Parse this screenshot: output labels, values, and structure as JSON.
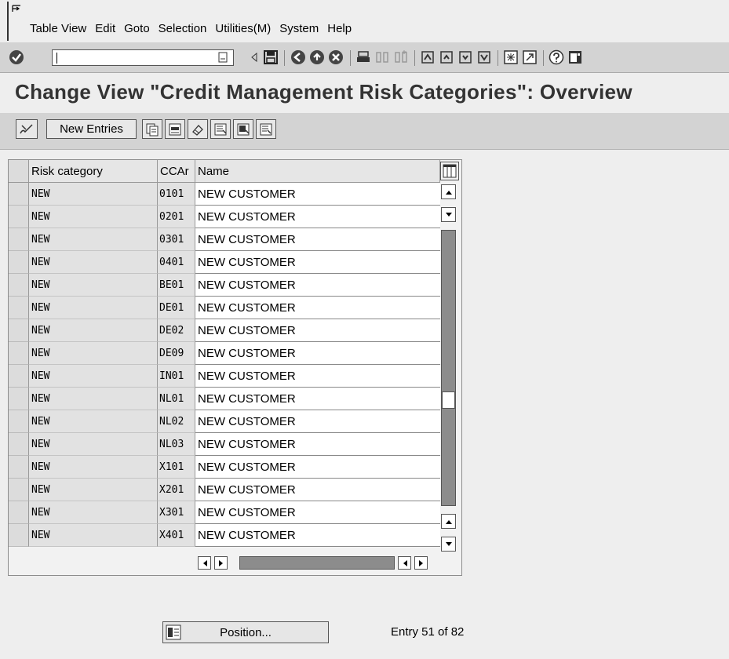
{
  "menu": {
    "items": [
      {
        "label": "Table View"
      },
      {
        "label": "Edit"
      },
      {
        "label": "Goto"
      },
      {
        "label": "Selection"
      },
      {
        "label": "Utilities(M)"
      },
      {
        "label": "System"
      },
      {
        "label": "Help"
      }
    ]
  },
  "command_field": {
    "value": ""
  },
  "page": {
    "title": "Change View \"Credit Management Risk Categories\": Overview"
  },
  "app_toolbar": {
    "new_entries_label": "New Entries"
  },
  "table": {
    "columns": [
      "Risk category",
      "CCAr",
      "Name"
    ],
    "rows": [
      [
        "NEW",
        "0101",
        "NEW CUSTOMER"
      ],
      [
        "NEW",
        "0201",
        "NEW CUSTOMER"
      ],
      [
        "NEW",
        "0301",
        "NEW CUSTOMER"
      ],
      [
        "NEW",
        "0401",
        "NEW CUSTOMER"
      ],
      [
        "NEW",
        "BE01",
        "NEW CUSTOMER"
      ],
      [
        "NEW",
        "DE01",
        "NEW CUSTOMER"
      ],
      [
        "NEW",
        "DE02",
        "NEW CUSTOMER"
      ],
      [
        "NEW",
        "DE09",
        "NEW CUSTOMER"
      ],
      [
        "NEW",
        "IN01",
        "NEW CUSTOMER"
      ],
      [
        "NEW",
        "NL01",
        "NEW CUSTOMER"
      ],
      [
        "NEW",
        "NL02",
        "NEW CUSTOMER"
      ],
      [
        "NEW",
        "NL03",
        "NEW CUSTOMER"
      ],
      [
        "NEW",
        "X101",
        "NEW CUSTOMER"
      ],
      [
        "NEW",
        "X201",
        "NEW CUSTOMER"
      ],
      [
        "NEW",
        "X301",
        "NEW CUSTOMER"
      ],
      [
        "NEW",
        "X401",
        "NEW CUSTOMER"
      ]
    ]
  },
  "footer": {
    "position_label": "Position...",
    "entry_info": "Entry 51 of 82"
  }
}
